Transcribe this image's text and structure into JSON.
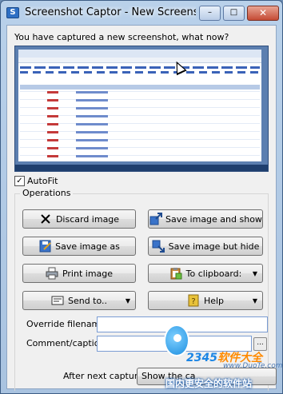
{
  "window": {
    "title": "Screenshot Captor - New Screensh",
    "controls": {
      "minimize": "–",
      "maximize": "□",
      "close": "✕"
    }
  },
  "prompt": "You have captured a new screenshot, what now?",
  "autofit": {
    "label": "AutoFit",
    "checked": true
  },
  "operations": {
    "group_label": "Operations",
    "discard": "Discard image",
    "save_and_show": "Save image and show",
    "save_as": "Save image as",
    "save_hide": "Save image but hide",
    "print": "Print image",
    "clipboard": "To clipboard:",
    "send_to": "Send to..",
    "help": "Help"
  },
  "override_filename": {
    "label": "Override filename:",
    "value": ""
  },
  "comment": {
    "label": "Comment/caption:",
    "value": "",
    "button": "..."
  },
  "after_capture": {
    "label": "After next capture:",
    "value": "Show the ca"
  },
  "watermark": {
    "brand_prefix": "2345",
    "brand_suffix": "软件大全",
    "url": "www.DuoTe.com",
    "slogan": "国内更安全的软件站"
  },
  "icons": {
    "discard": "x-icon",
    "save_show": "save-show-icon",
    "save_as": "save-as-icon",
    "save_hide": "save-hide-icon",
    "print": "printer-icon",
    "clipboard": "clipboard-icon",
    "send_to": "send-icon",
    "help": "help-book-icon"
  }
}
